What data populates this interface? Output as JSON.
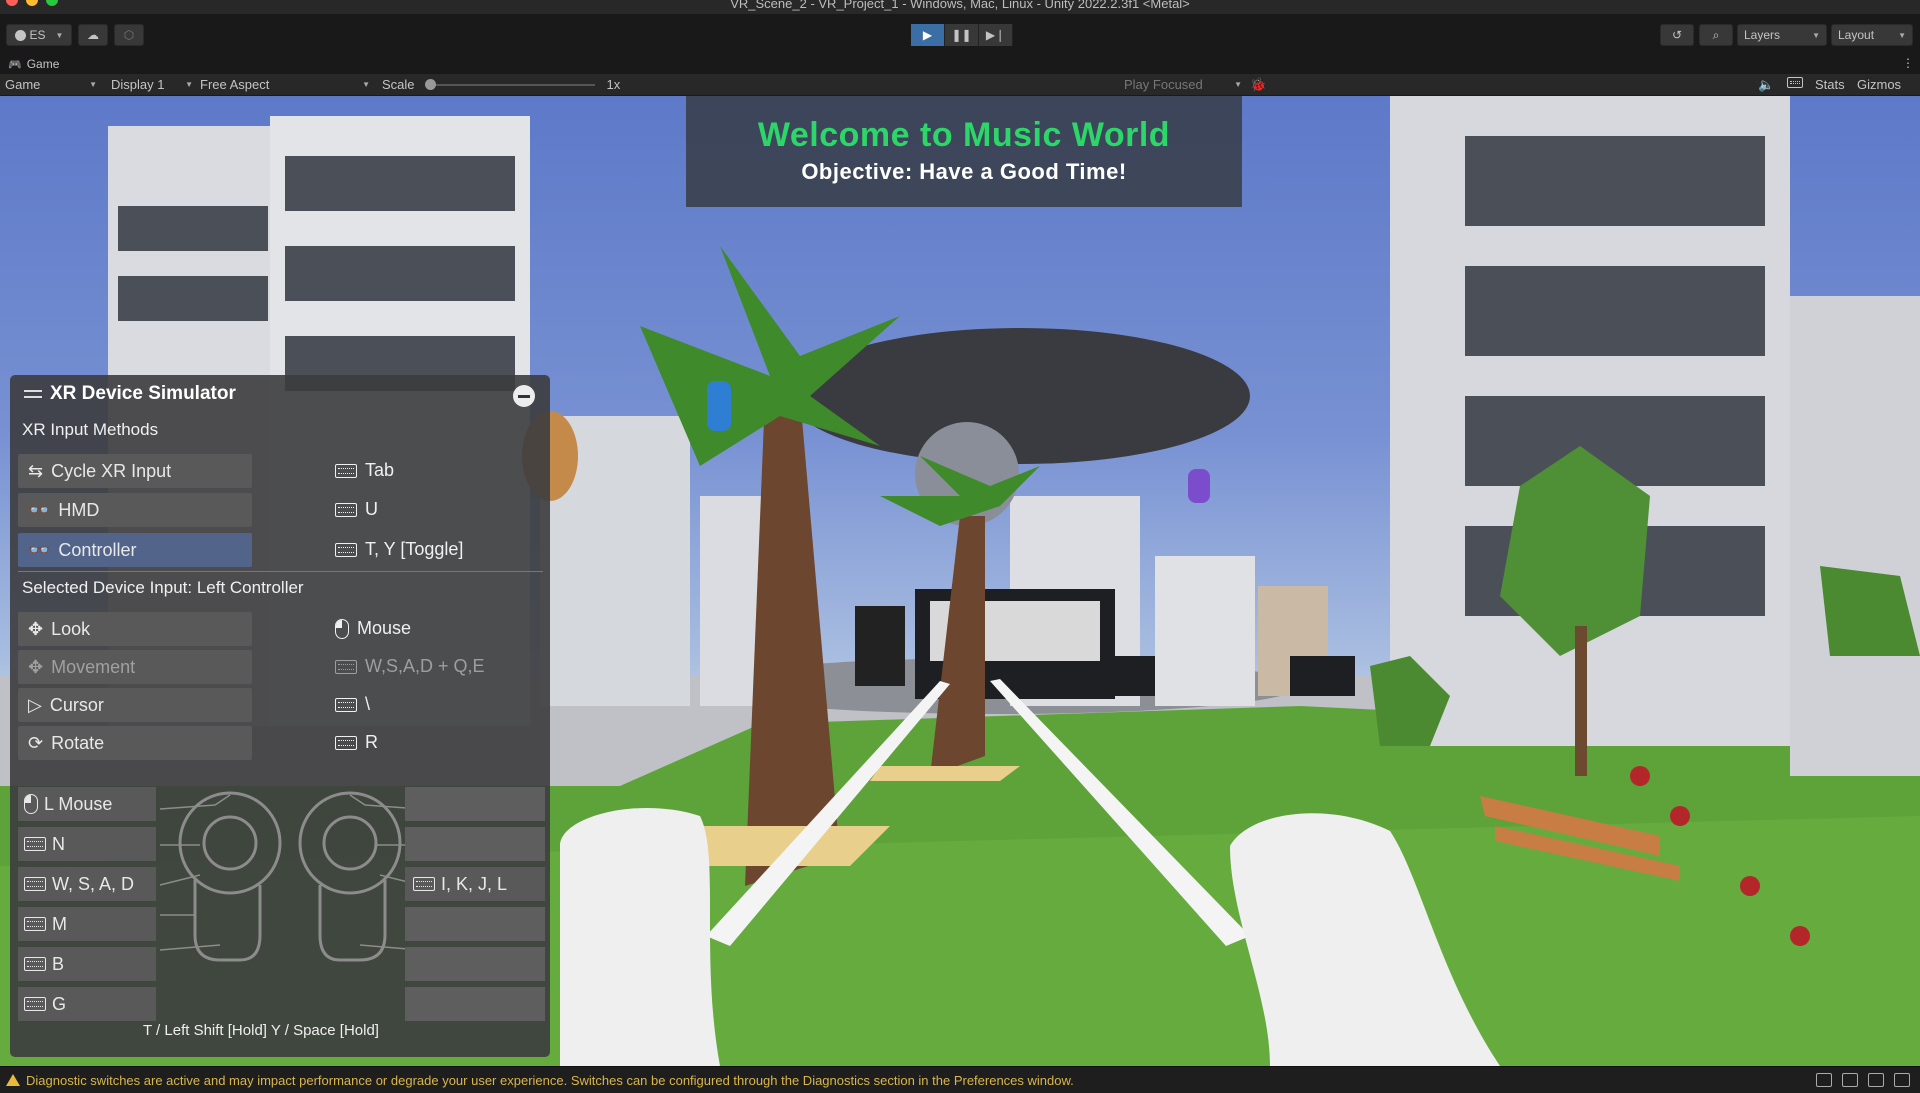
{
  "window": {
    "title": "VR_Scene_2 - VR_Project_1 - Windows, Mac, Linux - Unity 2022.2.3f1 <Metal>",
    "traffic_colors": [
      "#ff5f57",
      "#febc2e",
      "#28c840"
    ]
  },
  "toolbar": {
    "account_label": "ES",
    "layers_label": "Layers",
    "layout_label": "Layout"
  },
  "game_tab": {
    "label": "Game"
  },
  "gamebar": {
    "view_select": "Game",
    "display_select": "Display 1",
    "aspect_select": "Free Aspect",
    "scale_label": "Scale",
    "scale_value": "1x",
    "play_mode": "Play Focused",
    "stats_label": "Stats",
    "gizmos_label": "Gizmos"
  },
  "banner": {
    "title": "Welcome to Music World",
    "subtitle": "Objective: Have a Good Time!",
    "title_color": "#2cd668"
  },
  "xr_sim": {
    "title": "XR Device Simulator",
    "section_methods": "XR Input Methods",
    "methods": [
      {
        "label": "Cycle XR Input",
        "key": "Tab"
      },
      {
        "label": "HMD",
        "key": "U"
      },
      {
        "label": "Controller",
        "key": "T, Y [Toggle]"
      }
    ],
    "section_device": "Selected Device Input: Left Controller",
    "device_inputs": [
      {
        "label": "Look",
        "key": "Mouse"
      },
      {
        "label": "Movement",
        "key": "W,S,A,D + Q,E"
      },
      {
        "label": "Cursor",
        "key": "\\"
      },
      {
        "label": "Rotate",
        "key": "R"
      }
    ],
    "controller_left": [
      "L Mouse",
      "N",
      "W, S, A, D",
      "M",
      "B",
      "G"
    ],
    "controller_right": "I, K, J, L",
    "footer": "T / Left Shift [Hold]  Y / Space [Hold]"
  },
  "status_bar": {
    "message": "Diagnostic switches are active and may impact performance or degrade your user experience. Switches can be configured through the Diagnostics section in the Preferences window."
  }
}
